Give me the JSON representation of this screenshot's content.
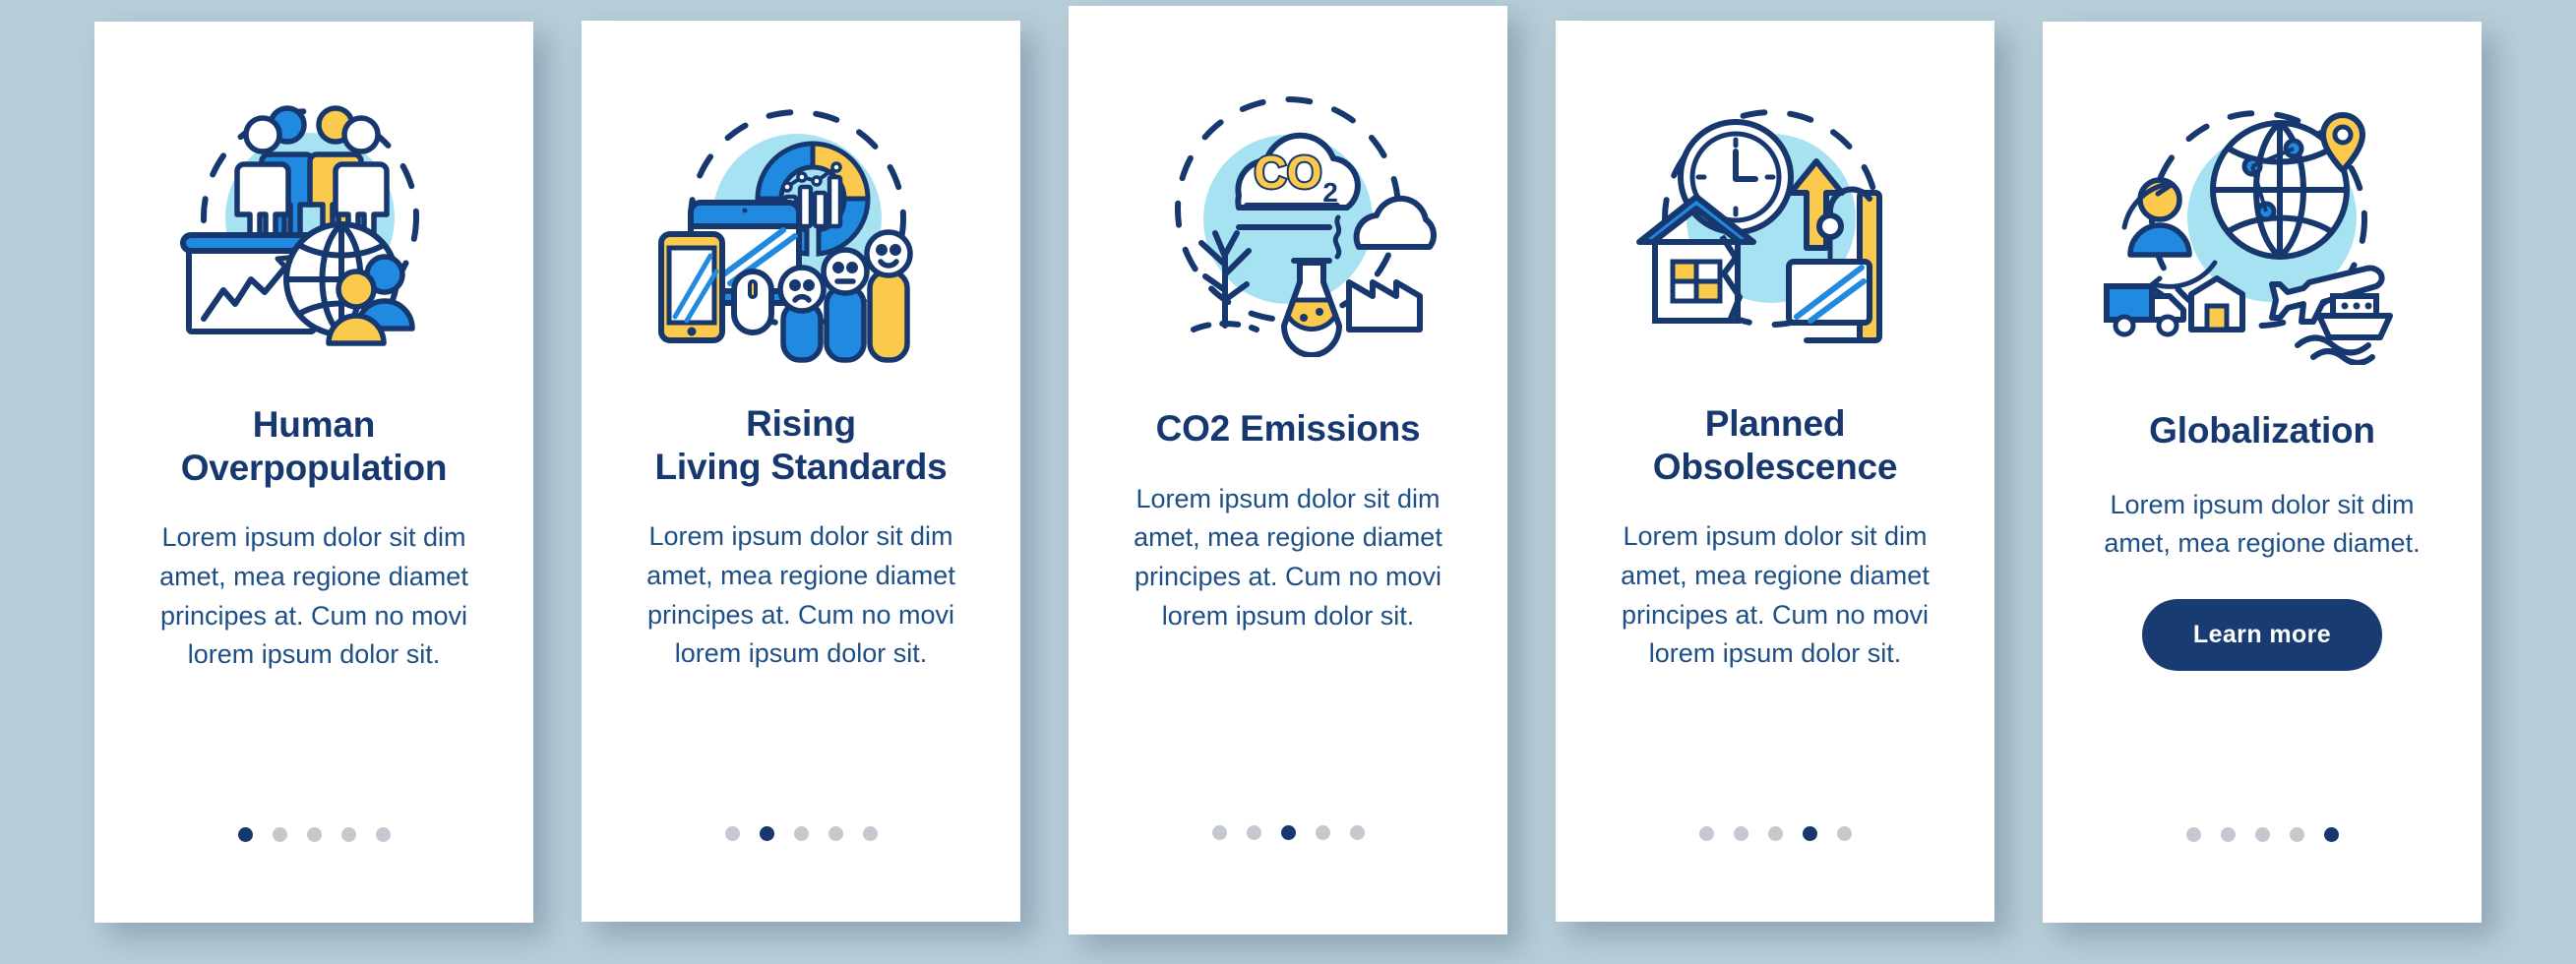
{
  "page": {
    "background_color": "#b7cdd8",
    "card_background": "#ffffff",
    "accent_navy": "#16386f",
    "accent_blue": "#1f8ae0",
    "accent_yellow": "#fbc94c",
    "accent_light_blue": "#a7e2f2",
    "dot_inactive": "#c3c9cf"
  },
  "cards": [
    {
      "icon_name": "human-overpopulation-illustration",
      "title": "Human\nOverpopulation",
      "body": "Lorem ipsum dolor sit dim amet, mea regione diamet principes at. Cum no movi lorem ipsum dolor sit.",
      "dots": {
        "count": 5,
        "active_index": 0
      },
      "has_button": false
    },
    {
      "icon_name": "rising-living-standards-illustration",
      "title": "Rising\nLiving Standards",
      "body": "Lorem ipsum dolor sit dim amet, mea regione diamet principes at. Cum no movi lorem ipsum dolor sit.",
      "dots": {
        "count": 5,
        "active_index": 1
      },
      "has_button": false
    },
    {
      "icon_name": "co2-emissions-illustration",
      "title": "CO2 Emissions",
      "body": "Lorem ipsum dolor sit dim amet, mea regione diamet principes at. Cum no movi lorem ipsum dolor sit.",
      "dots": {
        "count": 5,
        "active_index": 2
      },
      "has_button": false
    },
    {
      "icon_name": "planned-obsolescence-illustration",
      "title": "Planned\nObsolescence",
      "body": "Lorem ipsum dolor sit dim amet, mea regione diamet principes at. Cum no movi lorem ipsum dolor sit.",
      "dots": {
        "count": 5,
        "active_index": 3
      },
      "has_button": false
    },
    {
      "icon_name": "globalization-illustration",
      "title": "Globalization",
      "body": "Lorem ipsum dolor sit dim amet, mea regione diamet.",
      "button_label": "Learn more",
      "dots": {
        "count": 5,
        "active_index": 4
      },
      "has_button": true
    }
  ],
  "co2_label": "CO",
  "co2_sub": "2"
}
